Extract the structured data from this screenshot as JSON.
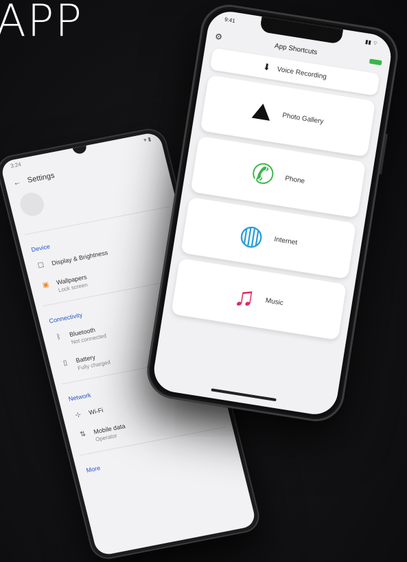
{
  "heading": "APP",
  "back_phone": {
    "status_left": "3:24",
    "status_right": "▾ ▮",
    "back_label": "Settings",
    "sections": [
      {
        "title": "Device",
        "rows": [
          {
            "icon": "display-icon",
            "glyph": "☐",
            "label": "Display & Brightness",
            "sub": ""
          },
          {
            "icon": "wallpaper-icon",
            "glyph": "▣",
            "label": "Wallpapers",
            "sub": "Lock screen"
          }
        ]
      },
      {
        "title": "Connectivity",
        "rows": [
          {
            "icon": "bluetooth-icon",
            "glyph": "ᛒ",
            "label": "Bluetooth",
            "sub": "Not connected"
          },
          {
            "icon": "battery-icon",
            "glyph": "▯",
            "label": "Battery",
            "sub": "Fully charged"
          }
        ]
      },
      {
        "title": "Network",
        "rows": [
          {
            "icon": "wifi-icon",
            "glyph": "⊹",
            "label": "Wi-Fi",
            "sub": ""
          },
          {
            "icon": "mobile-data-icon",
            "glyph": "⇅",
            "label": "Mobile data",
            "sub": "Operator"
          }
        ]
      }
    ],
    "footer_label": "More"
  },
  "front_phone": {
    "status_left": "9:41",
    "status_right": "▮▮ ⌔",
    "header_title": "App Shortcuts",
    "top_card": {
      "label": "Voice Recording",
      "icon": "arrow-down-icon",
      "glyph": "⬇"
    },
    "cards": [
      {
        "name": "card-photo-gallery",
        "icon": "mountain-icon",
        "glyph": "⛰",
        "label": "Photo Gallery",
        "color": "#111111"
      },
      {
        "name": "card-phone",
        "icon": "phone-icon",
        "glyph": "✆",
        "label": "Phone",
        "color": "#3bb54a"
      },
      {
        "name": "card-internet",
        "icon": "globe-icon",
        "glyph": "◍",
        "label": "Internet",
        "color": "#2a9fd8"
      },
      {
        "name": "card-music",
        "icon": "music-icon",
        "glyph": "♫",
        "label": "Music",
        "color": "#e0295d"
      }
    ]
  }
}
